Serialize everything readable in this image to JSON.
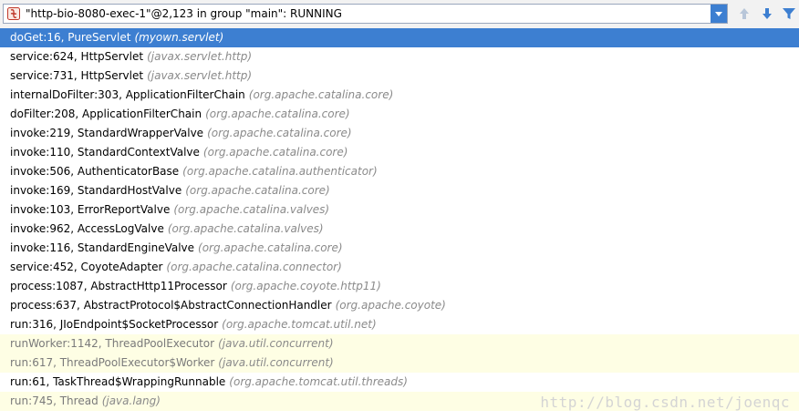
{
  "thread": {
    "label": "\"http-bio-8080-exec-1\"@2,123 in group \"main\": RUNNING",
    "icon": "thread-suspended-icon"
  },
  "toolbar": {
    "up_icon": "arrow-up-icon",
    "down_icon": "arrow-down-icon",
    "filter_icon": "filter-icon",
    "dropdown_icon": "chevron-down-icon"
  },
  "colors": {
    "selection": "#3d7fd1",
    "library_frame_bg": "#fefee4",
    "package_text": "#8a8a8a"
  },
  "frames": [
    {
      "method": "doGet:16, PureServlet",
      "pkg": "(myown.servlet)",
      "state": "selected"
    },
    {
      "method": "service:624, HttpServlet",
      "pkg": "(javax.servlet.http)",
      "state": "normal"
    },
    {
      "method": "service:731, HttpServlet",
      "pkg": "(javax.servlet.http)",
      "state": "normal"
    },
    {
      "method": "internalDoFilter:303, ApplicationFilterChain",
      "pkg": "(org.apache.catalina.core)",
      "state": "normal"
    },
    {
      "method": "doFilter:208, ApplicationFilterChain",
      "pkg": "(org.apache.catalina.core)",
      "state": "normal"
    },
    {
      "method": "invoke:219, StandardWrapperValve",
      "pkg": "(org.apache.catalina.core)",
      "state": "normal"
    },
    {
      "method": "invoke:110, StandardContextValve",
      "pkg": "(org.apache.catalina.core)",
      "state": "normal"
    },
    {
      "method": "invoke:506, AuthenticatorBase",
      "pkg": "(org.apache.catalina.authenticator)",
      "state": "normal"
    },
    {
      "method": "invoke:169, StandardHostValve",
      "pkg": "(org.apache.catalina.core)",
      "state": "normal"
    },
    {
      "method": "invoke:103, ErrorReportValve",
      "pkg": "(org.apache.catalina.valves)",
      "state": "normal"
    },
    {
      "method": "invoke:962, AccessLogValve",
      "pkg": "(org.apache.catalina.valves)",
      "state": "normal"
    },
    {
      "method": "invoke:116, StandardEngineValve",
      "pkg": "(org.apache.catalina.core)",
      "state": "normal"
    },
    {
      "method": "service:452, CoyoteAdapter",
      "pkg": "(org.apache.catalina.connector)",
      "state": "normal"
    },
    {
      "method": "process:1087, AbstractHttp11Processor",
      "pkg": "(org.apache.coyote.http11)",
      "state": "normal"
    },
    {
      "method": "process:637, AbstractProtocol$AbstractConnectionHandler",
      "pkg": "(org.apache.coyote)",
      "state": "normal"
    },
    {
      "method": "run:316, JIoEndpoint$SocketProcessor",
      "pkg": "(org.apache.tomcat.util.net)",
      "state": "normal"
    },
    {
      "method": "runWorker:1142, ThreadPoolExecutor",
      "pkg": "(java.util.concurrent)",
      "state": "lib"
    },
    {
      "method": "run:617, ThreadPoolExecutor$Worker",
      "pkg": "(java.util.concurrent)",
      "state": "lib"
    },
    {
      "method": "run:61, TaskThread$WrappingRunnable",
      "pkg": "(org.apache.tomcat.util.threads)",
      "state": "normal"
    },
    {
      "method": "run:745, Thread",
      "pkg": "(java.lang)",
      "state": "lib"
    }
  ],
  "watermark": "http://blog.csdn.net/joenqc"
}
